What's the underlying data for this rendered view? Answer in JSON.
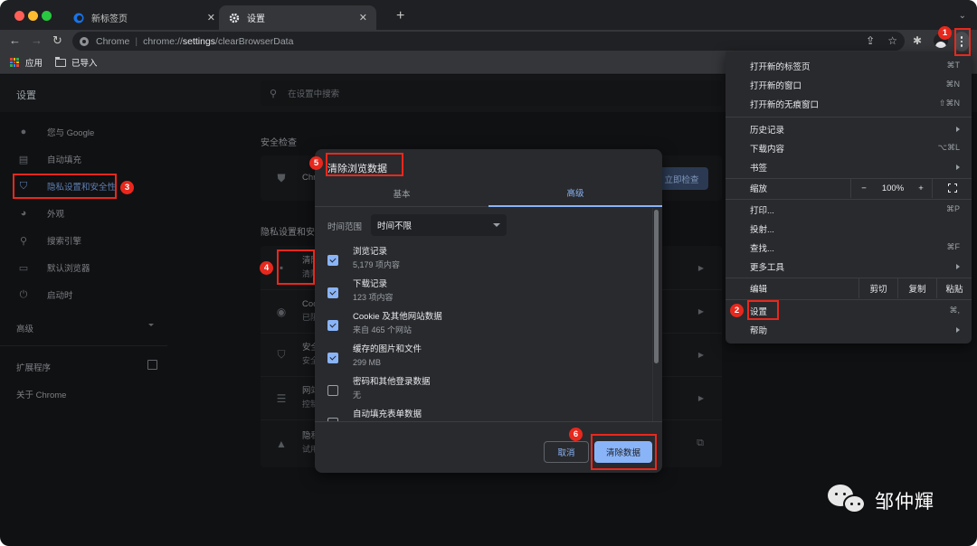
{
  "browser": {
    "tabs": [
      {
        "title": "新标签页",
        "icon": "new-tab-page-icon",
        "active": false
      },
      {
        "title": "设置",
        "icon": "gear-icon",
        "active": true
      }
    ],
    "new_tab_label": "+",
    "close_glyph": "✕",
    "omnibox": {
      "chip": "Chrome",
      "separator": "|",
      "url_prefix": "chrome://",
      "url_bold": "settings",
      "url_suffix": "/clearBrowserData"
    },
    "bookmarks": [
      {
        "label": "应用",
        "icon": "apps-grid-icon"
      },
      {
        "label": "已导入",
        "icon": "folder-icon"
      }
    ]
  },
  "settings": {
    "title": "设置",
    "search_placeholder": "在设置中搜索",
    "sidebar": [
      {
        "label": "您与 Google",
        "icon": "person-icon"
      },
      {
        "label": "自动填充",
        "icon": "clipboard-icon"
      },
      {
        "label": "隐私设置和安全性",
        "icon": "shield-icon",
        "active": true
      },
      {
        "label": "外观",
        "icon": "palette-icon"
      },
      {
        "label": "搜索引擎",
        "icon": "search-icon"
      },
      {
        "label": "默认浏览器",
        "icon": "browser-icon"
      },
      {
        "label": "启动时",
        "icon": "power-icon"
      }
    ],
    "advanced_label": "高级",
    "extensions_label": "扩展程序",
    "about_label": "关于 Chrome",
    "safety_check": {
      "heading": "安全检查",
      "row_text": "Chro",
      "button": "立即检查"
    },
    "privacy": {
      "heading": "隐私设置和安",
      "rows": [
        {
          "title": "清除",
          "sub": "清除",
          "icon": "trash-icon"
        },
        {
          "title": "Coo",
          "sub": "已阻",
          "icon": "cookie-icon"
        },
        {
          "title": "安全",
          "sub": "安全",
          "icon": "shield-icon"
        },
        {
          "title": "网站",
          "sub": "控制",
          "icon": "sliders-icon"
        },
        {
          "title": "隐私",
          "sub": "试用",
          "icon": "flask-icon"
        }
      ]
    }
  },
  "dialog": {
    "title": "清除浏览数据",
    "tabs": [
      "基本",
      "高级"
    ],
    "active_tab": "高级",
    "time_range_label": "时间范围",
    "time_range_value": "时间不限",
    "items": [
      {
        "title": "浏览记录",
        "sub": "5,179 项内容",
        "checked": true
      },
      {
        "title": "下载记录",
        "sub": "123 项内容",
        "checked": true
      },
      {
        "title": "Cookie 及其他网站数据",
        "sub": "来自 465 个网站",
        "checked": true
      },
      {
        "title": "缓存的图片和文件",
        "sub": "299 MB",
        "checked": true
      },
      {
        "title": "密码和其他登录数据",
        "sub": "无",
        "checked": false
      },
      {
        "title": "自动填充表单数据",
        "sub": "",
        "checked": false
      }
    ],
    "cancel_label": "取消",
    "confirm_label": "清除数据"
  },
  "menu": {
    "group1": [
      {
        "label": "打开新的标签页",
        "shortcut": "⌘T"
      },
      {
        "label": "打开新的窗口",
        "shortcut": "⌘N"
      },
      {
        "label": "打开新的无痕窗口",
        "shortcut": "⇧⌘N"
      }
    ],
    "group2": [
      {
        "label": "历史记录",
        "submenu": true
      },
      {
        "label": "下载内容",
        "shortcut": "⌥⌘L"
      },
      {
        "label": "书签",
        "submenu": true
      }
    ],
    "zoom": {
      "label": "缩放",
      "minus": "−",
      "value": "100%",
      "plus": "+"
    },
    "group3": [
      {
        "label": "打印...",
        "shortcut": "⌘P"
      },
      {
        "label": "投射...",
        "shortcut": ""
      },
      {
        "label": "查找...",
        "shortcut": "⌘F"
      },
      {
        "label": "更多工具",
        "submenu": true
      }
    ],
    "edit": {
      "label": "编辑",
      "cut": "剪切",
      "copy": "复制",
      "paste": "粘贴"
    },
    "group4": [
      {
        "label": "设置",
        "shortcut": "⌘,"
      },
      {
        "label": "帮助",
        "submenu": true
      }
    ]
  },
  "annotations": [
    "1",
    "2",
    "3",
    "4",
    "5",
    "6"
  ],
  "annotation_color": "#e8281d",
  "accent_color": "#8ab4f8",
  "watermark": {
    "text": "邹仲輝",
    "icon": "wechat-icon"
  }
}
